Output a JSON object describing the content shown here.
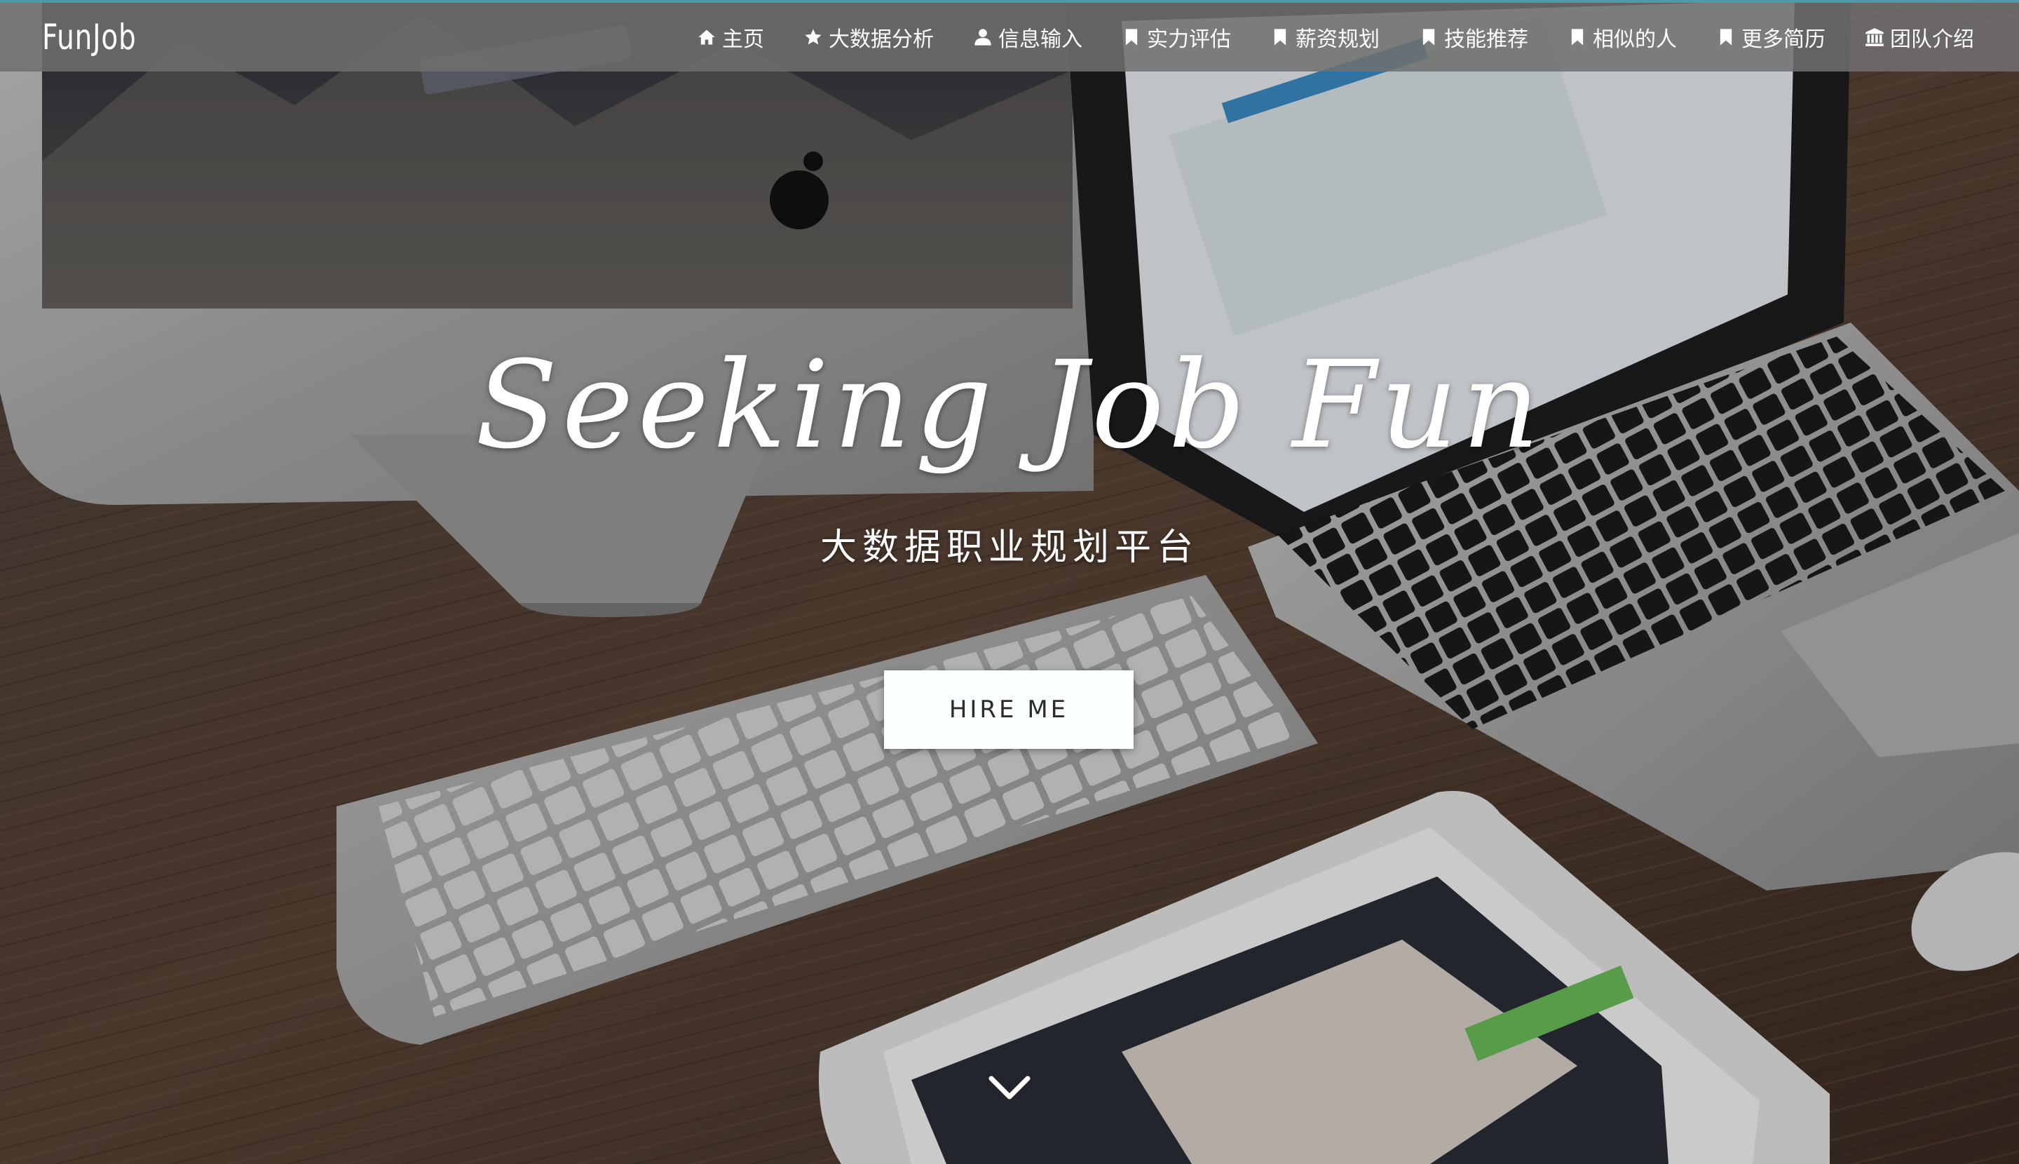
{
  "header": {
    "brand": "FunJob",
    "accent_color": "#4d9aa8",
    "nav": [
      {
        "icon": "home-icon",
        "label": "主页"
      },
      {
        "icon": "star-icon",
        "label": "大数据分析"
      },
      {
        "icon": "user-icon",
        "label": "信息输入"
      },
      {
        "icon": "bookmark-icon",
        "label": "实力评估"
      },
      {
        "icon": "bookmark-icon",
        "label": "薪资规划"
      },
      {
        "icon": "bookmark-icon",
        "label": "技能推荐"
      },
      {
        "icon": "bookmark-icon",
        "label": "相似的人"
      },
      {
        "icon": "bookmark-icon",
        "label": "更多简历"
      },
      {
        "icon": "bank-icon",
        "label": "团队介绍"
      }
    ]
  },
  "hero": {
    "title": "Seeking Job Fun",
    "subtitle": "大数据职业规划平台",
    "button_label": "HIRE ME",
    "scroll_icon": "chevron-down-icon"
  }
}
